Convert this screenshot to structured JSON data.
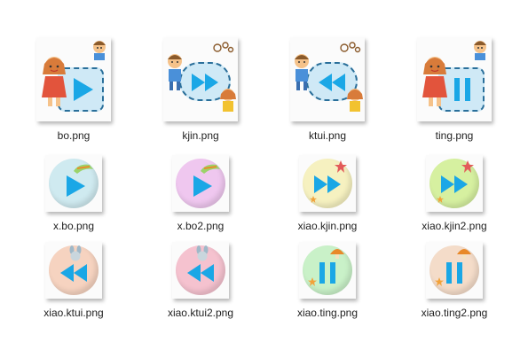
{
  "files": {
    "row1": [
      {
        "name": "bo.png",
        "icon": "play-icon"
      },
      {
        "name": "kjin.png",
        "icon": "fast-forward-icon"
      },
      {
        "name": "ktui.png",
        "icon": "rewind-icon"
      },
      {
        "name": "ting.png",
        "icon": "pause-icon"
      }
    ],
    "row2": [
      {
        "name": "x.bo.png",
        "icon": "play-icon",
        "color": "#cfeaf0"
      },
      {
        "name": "x.bo2.png",
        "icon": "play-icon",
        "color": "#efc7ef"
      },
      {
        "name": "xiao.kjin.png",
        "icon": "fast-forward-icon",
        "color": "#f6f1c0"
      },
      {
        "name": "xiao.kjin2.png",
        "icon": "fast-forward-icon",
        "color": "#d6f0a0"
      }
    ],
    "row3": [
      {
        "name": "xiao.ktui.png",
        "icon": "rewind-icon",
        "color": "#f6d3c0"
      },
      {
        "name": "xiao.ktui2.png",
        "icon": "rewind-icon",
        "color": "#f5c2cf"
      },
      {
        "name": "xiao.ting.png",
        "icon": "pause-icon",
        "color": "#c9f1c8"
      },
      {
        "name": "xiao.ting2.png",
        "icon": "pause-icon",
        "color": "#f4dcc9"
      }
    ]
  },
  "colors": {
    "accent": "#1aa7e6",
    "panel": "#cfe9f6",
    "panel_border": "#2a6f9a"
  }
}
